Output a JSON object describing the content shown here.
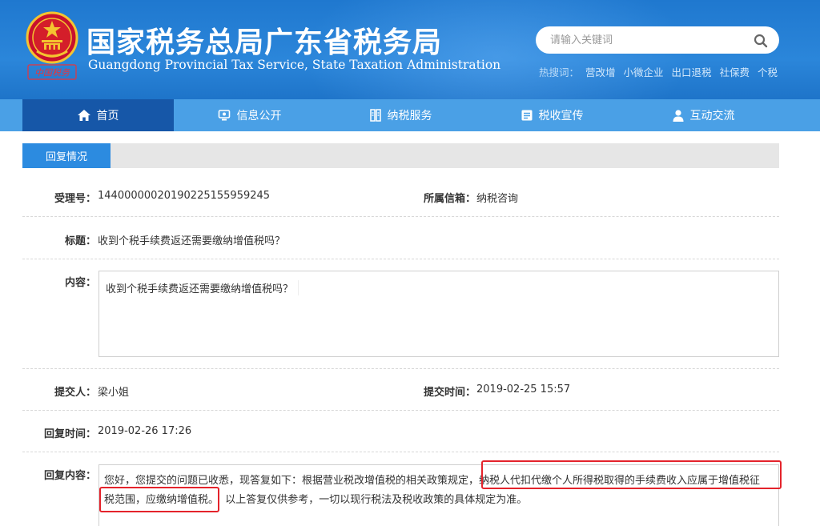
{
  "header": {
    "title_cn": "国家税务总局广东省税务局",
    "title_en": "Guangdong Provincial Tax Service, State Taxation Administration",
    "seal_text": "中国税务",
    "search": {
      "placeholder": "请输入关键词"
    },
    "hotwords_label": "热搜词：",
    "hotwords": [
      "营改增",
      "小微企业",
      "出口退税",
      "社保费",
      "个税"
    ]
  },
  "nav": {
    "items": [
      {
        "label": "首页",
        "icon": "home-icon"
      },
      {
        "label": "信息公开",
        "icon": "info-icon"
      },
      {
        "label": "纳税服务",
        "icon": "service-icon"
      },
      {
        "label": "税收宣传",
        "icon": "publicity-icon"
      },
      {
        "label": "互动交流",
        "icon": "user-icon"
      }
    ],
    "active_index": 0
  },
  "panel": {
    "tab_label": "回复情况",
    "fields": {
      "accept_no": {
        "label": "受理号：",
        "value": "14400000020190225155959245"
      },
      "mailbox": {
        "label": "所属信箱：",
        "value": "纳税咨询"
      },
      "subject": {
        "label": "标题：",
        "value": "收到个税手续费返还需要缴纳增值税吗？"
      },
      "content": {
        "label": "内容：",
        "value": "收到个税手续费返还需要缴纳增值税吗？"
      },
      "submitter": {
        "label": "提交人：",
        "value": "梁小姐"
      },
      "submit_time": {
        "label": "提交时间：",
        "value": "2019-02-25 15:57"
      },
      "reply_time": {
        "label": "回复时间：",
        "value": "2019-02-26 17:26"
      },
      "reply_content": {
        "label": "回复内容：",
        "part1": "您好，您提交的问题已收悉，现答复如下：根据营业税改增值税的相关政策规定，",
        "part2": "纳税人代扣代缴个人所得税取得的手续费收入应属于增值税征",
        "part3": "税范围，应缴纳增值税。",
        "part4": "以上答复仅供参考，一切以现行税法及税收政策的具体规定为准。"
      }
    }
  },
  "colors": {
    "header_blue": "#2580d4",
    "nav_blue": "#4aa0e6",
    "nav_active": "#1657a8",
    "tab_blue": "#2c8be0",
    "highlight_red": "#e4232b"
  }
}
